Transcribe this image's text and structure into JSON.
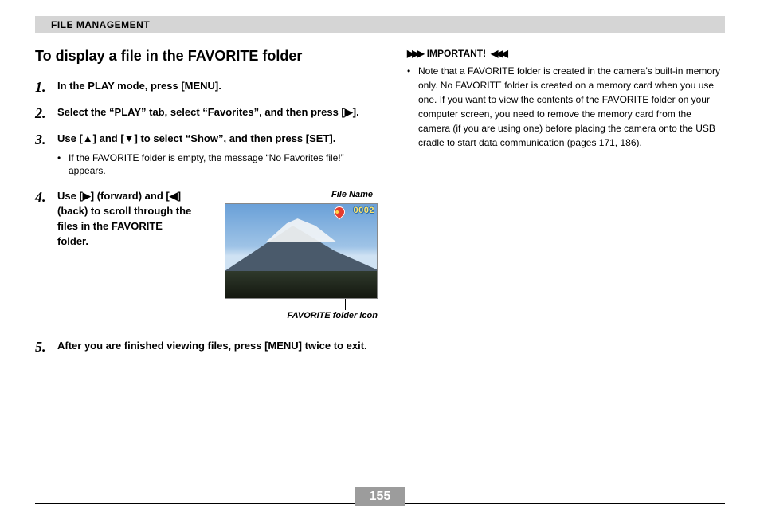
{
  "section_header": "FILE MANAGEMENT",
  "left": {
    "title": "To display a file in the FAVORITE folder",
    "steps": {
      "s1": "In the PLAY mode, press [MENU].",
      "s2": "Select the “PLAY” tab, select “Favorites”, and then press [▶].",
      "s3": "Use [▲] and [▼] to select “Show”, and then press [SET].",
      "s3_sub": "If the FAVORITE folder is empty, the message “No Favorites file!” appears.",
      "s4": "Use [▶] (forward) and [◀] (back) to scroll through the files in the FAVORITE folder.",
      "s5": "After you are finished viewing files, press [MENU] twice to exit."
    },
    "figure": {
      "file_name_label": "File Name",
      "file_number": "0002",
      "folder_icon_label": "FAVORITE folder icon"
    }
  },
  "right": {
    "important_label": "IMPORTANT!",
    "note": "Note that a FAVORITE folder is created in the camera’s built-in memory only. No FAVORITE folder is created on a memory card when you use one. If you want to view the contents of the FAVORITE folder on your computer screen, you need to remove the memory card from the camera (if you are using one) before placing the camera onto the USB cradle to start data communication (pages 171, 186)."
  },
  "page_number": "155"
}
